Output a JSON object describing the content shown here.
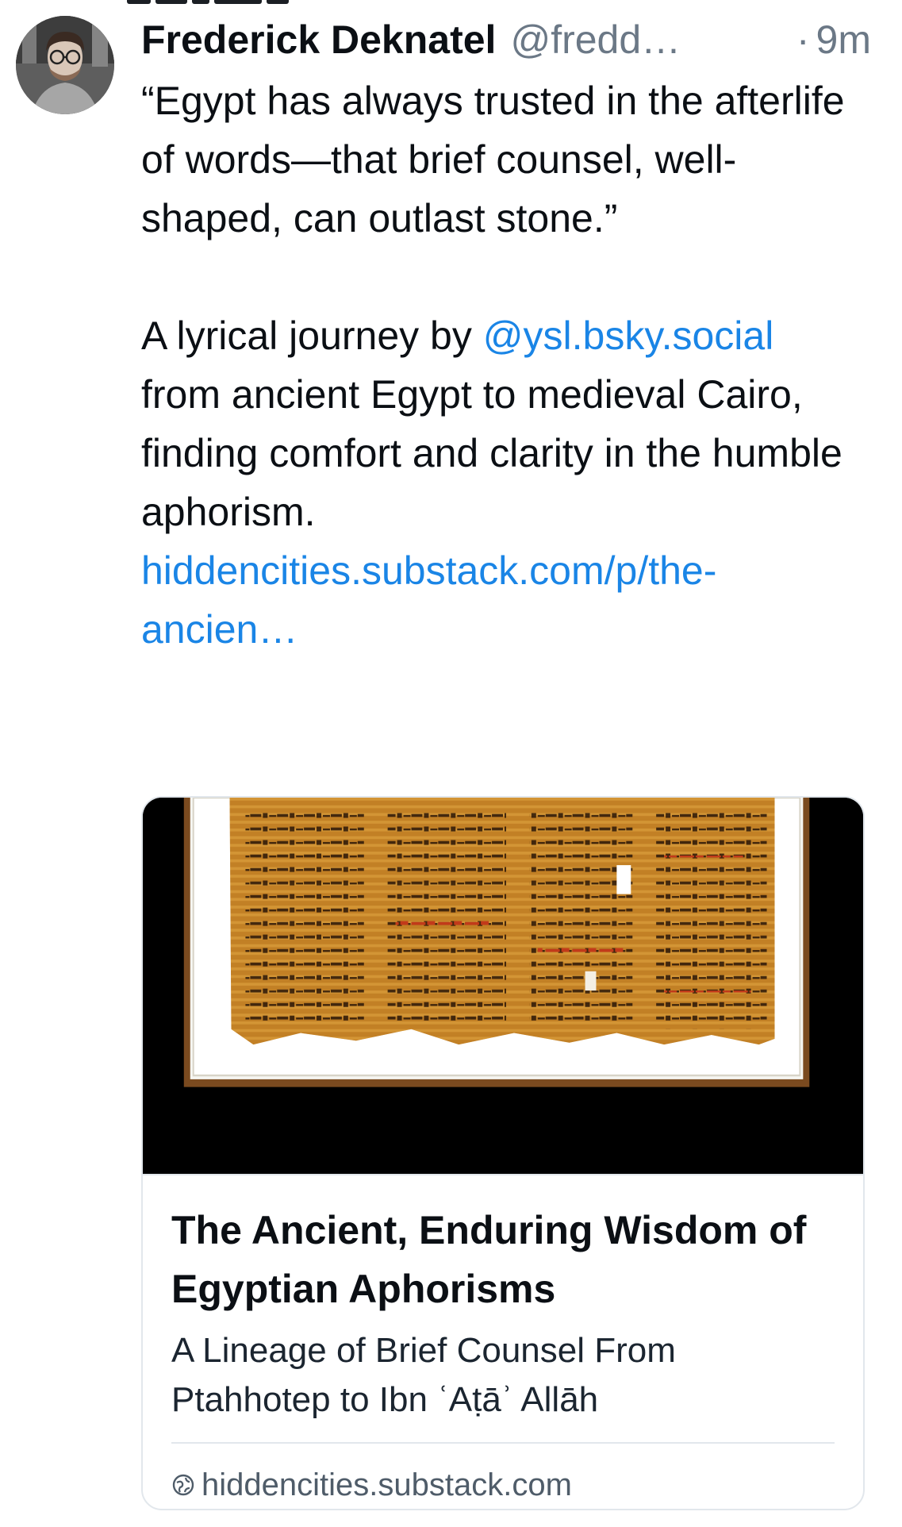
{
  "post": {
    "author": {
      "display_name": "Frederick Deknatel",
      "handle": "@fredd…",
      "avatar_icon": "avatar-photo"
    },
    "time_separator": "·",
    "timestamp": "9m",
    "text": {
      "quote": "“Egypt has always trusted in the afterlife of words—that brief counsel, well-shaped, can outlast stone.”",
      "body_prefix": "A lyrical journey by ",
      "mention": "@ysl.bsky.social",
      "body_suffix": " from ancient Egypt to medieval Cairo, finding comfort and clarity in the humble aphorism.",
      "link": "hiddencities.substack.com/p/the-ancien…"
    },
    "link_card": {
      "image_icon": "papyrus-image",
      "title": "The Ancient, Enduring Wisdom of Egyptian Aphorisms",
      "description": "A Lineage of Brief Counsel From Ptahhotep to Ibn ʿAṭāʾ Allāh",
      "domain": "hiddencities.substack.com",
      "domain_icon": "globe-icon"
    }
  },
  "colors": {
    "link": "#1a85e6",
    "muted": "#6b7886",
    "border": "#e2e7ec",
    "text": "#0b0f14"
  }
}
